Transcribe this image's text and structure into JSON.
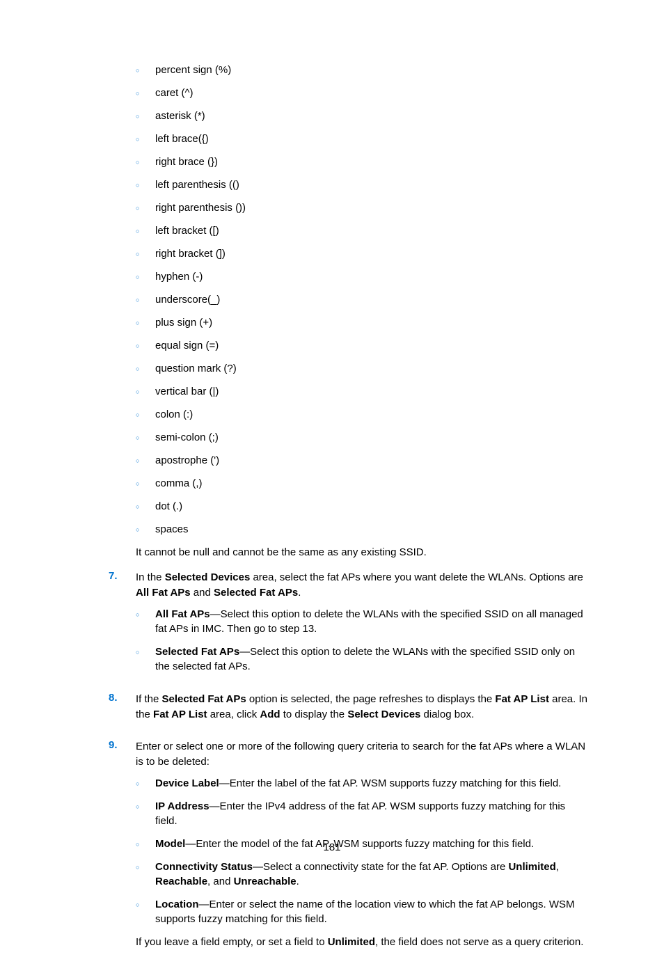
{
  "chars": [
    "percent sign (%)",
    "caret (^)",
    "asterisk (*)",
    "left brace({)",
    "right brace (})",
    "left parenthesis (()",
    "right parenthesis ())",
    "left bracket ([)",
    "right bracket (])",
    "hyphen (-)",
    "underscore(_)",
    "plus sign (+)",
    "equal sign (=)",
    "question mark (?)",
    "vertical bar (|)",
    "colon (:)",
    "semi-colon (;)",
    "apostrophe (')",
    "comma (,)",
    "dot (.)",
    "spaces"
  ],
  "note": "It cannot be null and cannot be the same as any existing SSID.",
  "step7": {
    "num": "7.",
    "p1a": "In the ",
    "p1b": "Selected Devices",
    "p1c": " area, select the fat APs where you want delete the WLANs. Options are ",
    "p1d": "All Fat APs",
    "p1e": " and ",
    "p1f": "Selected Fat APs",
    "p1g": ".",
    "s1a": "All Fat APs",
    "s1b": "—Select this option to delete the WLANs with the specified SSID on all managed fat APs in IMC. Then go to step 13.",
    "s2a": "Selected Fat APs",
    "s2b": "—Select this option to delete the WLANs with the specified SSID only on the selected fat APs."
  },
  "step8": {
    "num": "8.",
    "a": "If the ",
    "b": "Selected Fat APs",
    "c": " option is selected, the page refreshes to displays the ",
    "d": "Fat AP List",
    "e": " area. In the ",
    "f": "Fat AP List",
    "g": " area, click ",
    "h": "Add",
    "i": " to display the ",
    "j": "Select Devices",
    "k": " dialog box."
  },
  "step9": {
    "num": "9.",
    "p1": "Enter or select one or more of the following query criteria to search for the fat APs where a WLAN is to be deleted:",
    "s1a": "Device Label",
    "s1b": "—Enter the label of the fat AP. WSM supports fuzzy matching for this field.",
    "s2a": "IP Address",
    "s2b": "—Enter the IPv4 address of the fat AP. WSM supports fuzzy matching for this field.",
    "s3a": "Model",
    "s3b": "—Enter the model of the fat AP. WSM supports fuzzy matching for this field.",
    "s4a": "Connectivity Status",
    "s4b": "—Select a connectivity state for the fat AP. Options are ",
    "s4c": "Unlimited",
    "s4d": ", ",
    "s4e": "Reachable",
    "s4f": ", and ",
    "s4g": "Unreachable",
    "s4h": ".",
    "s5a": "Location",
    "s5b": "—Enter or select the name of the location view to which the fat AP belongs. WSM supports fuzzy matching for this field.",
    "p2a": "If you leave a field empty, or set a field to ",
    "p2b": "Unlimited",
    "p2c": ", the field does not serve as a query criterion."
  },
  "pagenum": "181"
}
